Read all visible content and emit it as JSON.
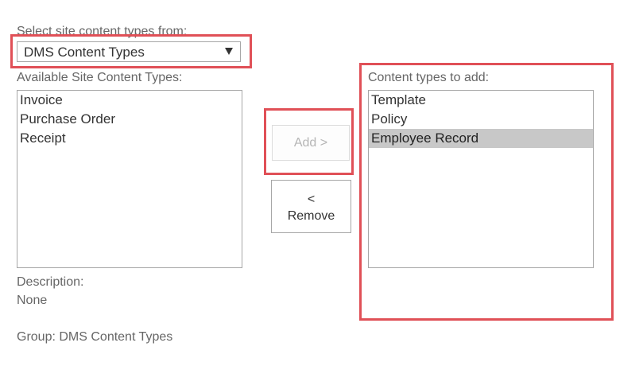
{
  "select_section": {
    "label": "Select site content types from:",
    "value": "DMS Content Types"
  },
  "available": {
    "label": "Available Site Content Types:",
    "items": [
      "Invoice",
      "Purchase Order",
      "Receipt"
    ]
  },
  "buttons": {
    "add_label": "Add >",
    "remove_line1": "<",
    "remove_line2": "Remove"
  },
  "to_add": {
    "label": "Content types to add:",
    "items": [
      "Template",
      "Policy",
      "Employee Record"
    ],
    "selected_item": "Employee Record"
  },
  "description": {
    "label": "Description:",
    "value": "None"
  },
  "group": {
    "text": "Group: DMS Content Types"
  },
  "colors": {
    "highlight": "#e05057",
    "selected_row": "#c8c8c8",
    "text": "#333333",
    "muted_text": "#666666"
  }
}
